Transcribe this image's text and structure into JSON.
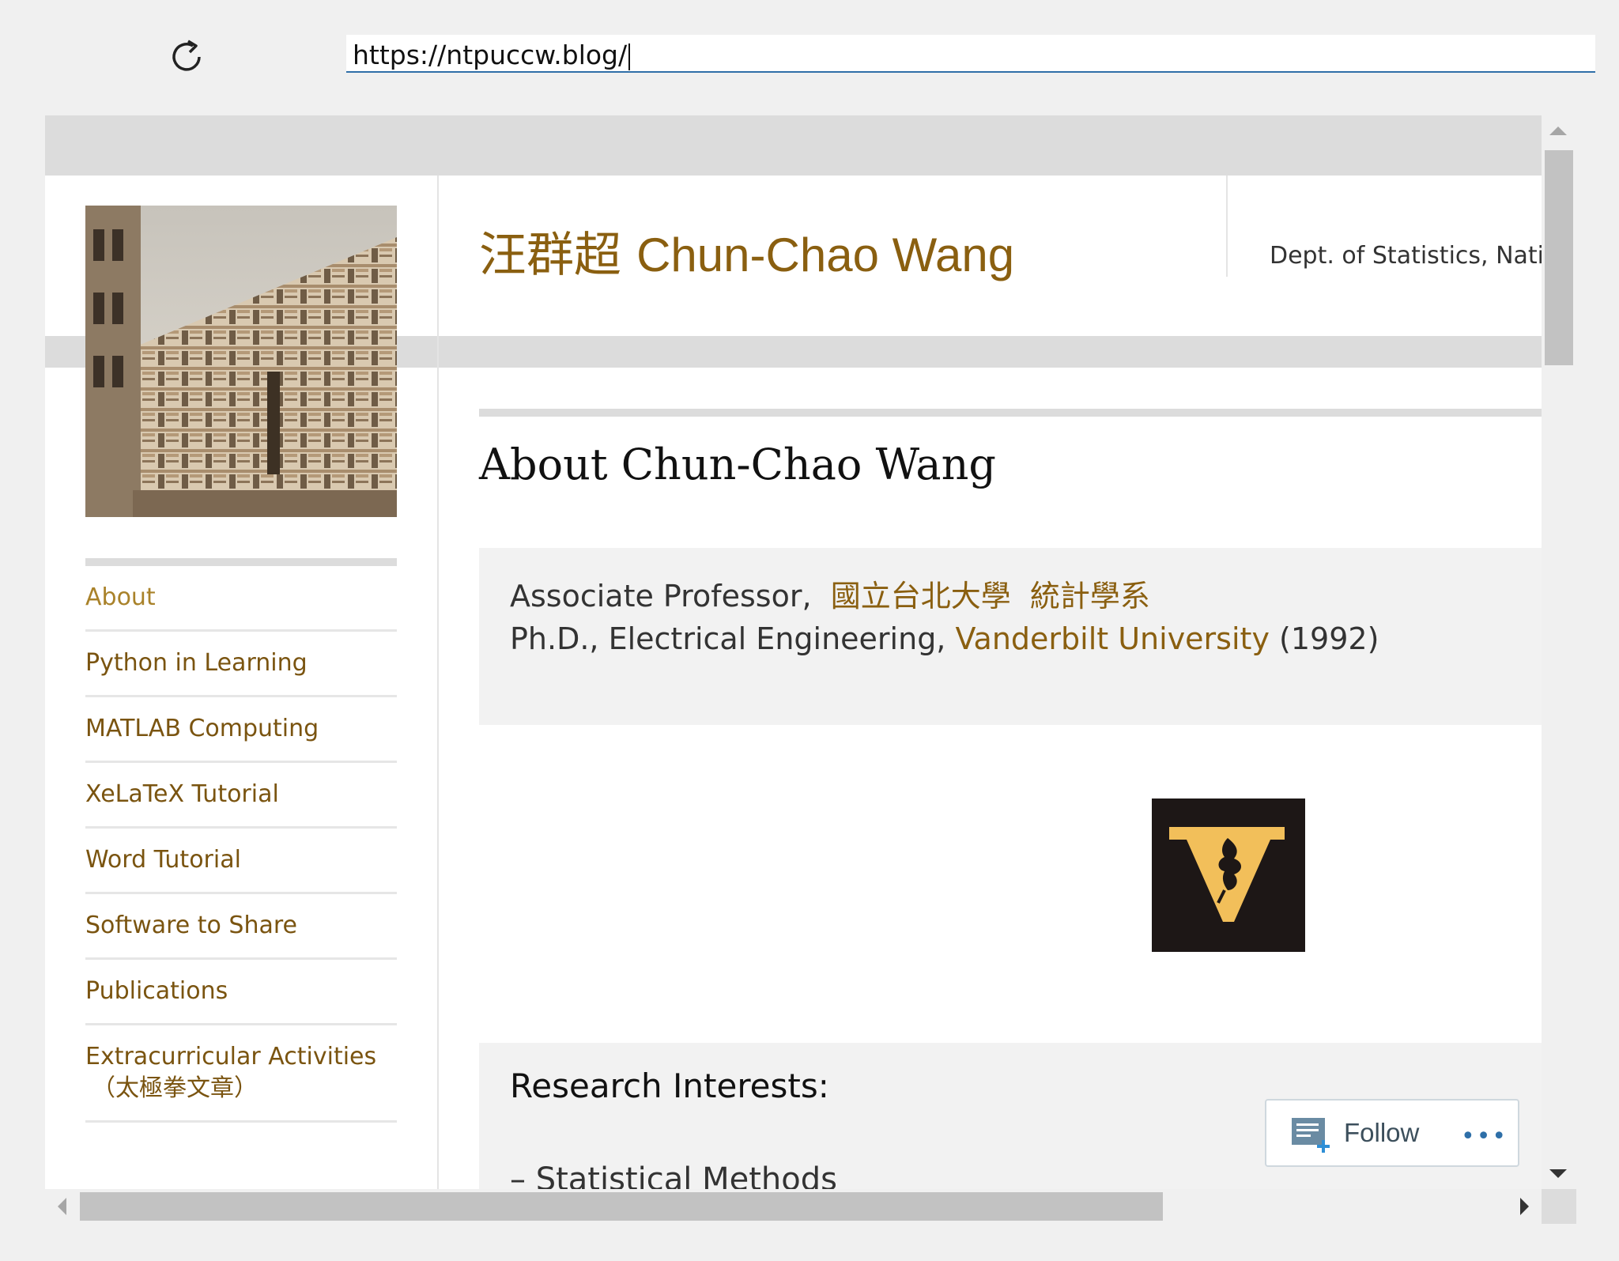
{
  "browser": {
    "url": "https://ntpuccw.blog/",
    "reload_icon": "reload-icon"
  },
  "site": {
    "title_cjk": "汪群超",
    "title_en": "Chun-Chao Wang",
    "tagline": "Dept. of Statistics, Nati"
  },
  "nav": {
    "items": [
      {
        "label": "About",
        "active": true
      },
      {
        "label": "Python in Learning"
      },
      {
        "label": "MATLAB Computing"
      },
      {
        "label": "XeLaTeX Tutorial"
      },
      {
        "label": "Word Tutorial"
      },
      {
        "label": "Software to Share"
      },
      {
        "label": "Publications"
      },
      {
        "label": "Extracurricular Activities",
        "sub": "（太極拳文章）"
      }
    ]
  },
  "page": {
    "title": "About Chun-Chao Wang",
    "position_prefix": "Associate Professor,",
    "university_link": "國立台北大學",
    "department_link": "統計學系",
    "degree_prefix": "Ph.D., Electrical Engineering,",
    "degree_school_link": "Vanderbilt University",
    "degree_year": "(1992)",
    "logo_icon": "vanderbilt-logo-icon",
    "research_title": "Research Interests:",
    "research_first_item": "– Statistical Methods"
  },
  "follow_widget": {
    "label": "Follow",
    "more": "•••"
  },
  "colors": {
    "accent_brown": "#8a5f10",
    "active_gold": "#a9822a",
    "logo_gold": "#f2bf5a",
    "logo_dark": "#1d1716",
    "address_underline": "#2f6fa8"
  }
}
